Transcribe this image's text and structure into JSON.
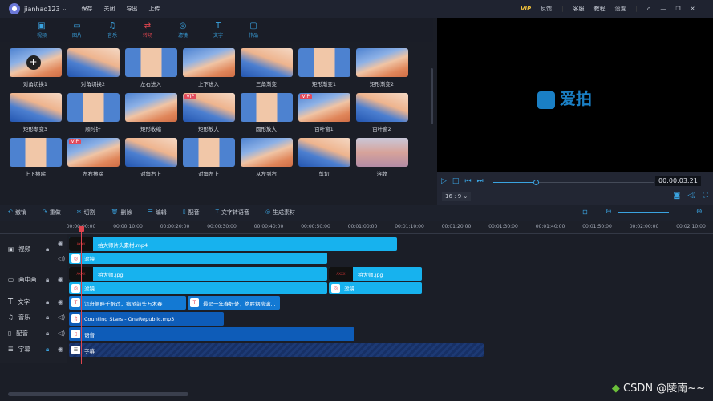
{
  "topbar": {
    "username": "jianhao123",
    "menu": [
      "保存",
      "关闭",
      "导出",
      "上传"
    ],
    "vip": "VIP",
    "feedback": "反馈",
    "right": [
      "客服",
      "教程",
      "设置"
    ]
  },
  "tabs": [
    {
      "label": "视频",
      "icon": "video-icon"
    },
    {
      "label": "图片",
      "icon": "image-icon"
    },
    {
      "label": "音乐",
      "icon": "music-icon"
    },
    {
      "label": "转场",
      "icon": "transition-icon",
      "active": true
    },
    {
      "label": "滤镜",
      "icon": "filter-icon"
    },
    {
      "label": "文字",
      "icon": "text-icon"
    },
    {
      "label": "作品",
      "icon": "folder-icon"
    }
  ],
  "transitions": [
    {
      "label": "对角切换1"
    },
    {
      "label": "对角切换2"
    },
    {
      "label": "左右进入"
    },
    {
      "label": "上下进入"
    },
    {
      "label": "三角渐变"
    },
    {
      "label": "矩形渐变1"
    },
    {
      "label": "矩形渐变2"
    },
    {
      "label": "矩形渐变3"
    },
    {
      "label": "顺时针"
    },
    {
      "label": "矩形收缩"
    },
    {
      "label": "矩形放大",
      "vip": "VIP"
    },
    {
      "label": "圆形放大"
    },
    {
      "label": "百叶窗1",
      "vip": "VIP"
    },
    {
      "label": "百叶窗2"
    },
    {
      "label": "上下擦除"
    },
    {
      "label": "左右擦除",
      "vip": "VIP"
    },
    {
      "label": "对角右上"
    },
    {
      "label": "对角左上"
    },
    {
      "label": "从左到右"
    },
    {
      "label": "剪切"
    },
    {
      "label": "溶散"
    }
  ],
  "preview": {
    "logo": "爱拍",
    "timecode": "00:00:03:21",
    "aspect": "16 : 9",
    "progress": 0.25
  },
  "toolbar": [
    "撤销",
    "重做",
    "切割",
    "删除",
    "编辑",
    "配音",
    "文字转语音",
    "生成素材"
  ],
  "ruler": [
    "00:00:00:00",
    "00:00:10:00",
    "00:00:20:00",
    "00:00:30:00",
    "00:00:40:00",
    "00:00:50:00",
    "00:01:00:00",
    "00:01:10:00",
    "00:01:20:00",
    "00:01:30:00",
    "00:01:40:00",
    "00:01:50:00",
    "00:02:00:00",
    "00:02:10:00"
  ],
  "tracks": {
    "video": "视频",
    "pip": "画中画",
    "text": "文字",
    "music": "音乐",
    "voice": "配音",
    "subtitle": "字幕"
  },
  "clips": {
    "video": "拍大师片头素材.mp4",
    "filter": "滤镜",
    "pip1": "拍大师.jpg",
    "pip2": "拍大师.jpg",
    "text1": "沉舟侧畔千帆过，病树前头万木春",
    "text2": "最是一年春好处，绝胜烟柳满...",
    "music": "Counting Stars - OneRepublic.mp3",
    "voice": "语音",
    "subtitle": "字幕"
  },
  "watermark": "CSDN @陵南~~"
}
